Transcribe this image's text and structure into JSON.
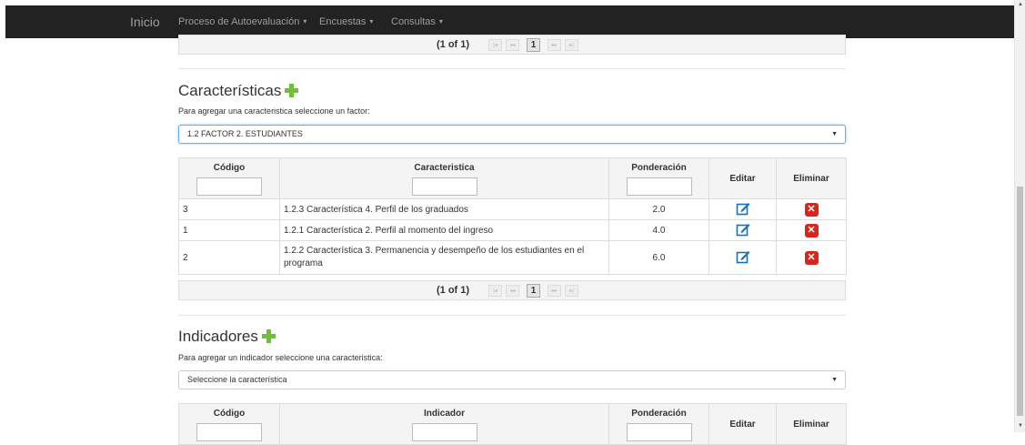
{
  "navbar": {
    "brand": "Inicio",
    "menus": [
      {
        "label": "Proceso de Autoevaluación"
      },
      {
        "label": "Encuestas"
      },
      {
        "label": "Consultas"
      }
    ]
  },
  "top_paginator": {
    "text": "(1 of 1)",
    "page": "1"
  },
  "caracteristicas": {
    "title": "Características",
    "hint": "Para agregar una caracteristica seleccione un factor:",
    "selected_factor": "1.2 FACTOR 2. ESTUDIANTES",
    "columns": [
      "Código",
      "Caracteristica",
      "Ponderación",
      "Editar",
      "Eliminar"
    ],
    "rows": [
      {
        "codigo": "3",
        "caracteristica": "1.2.3 Característica 4. Perfil de los graduados",
        "ponderacion": "2.0"
      },
      {
        "codigo": "1",
        "caracteristica": "1.2.1 Característica 2. Perfil al momento del ingreso",
        "ponderacion": "4.0"
      },
      {
        "codigo": "2",
        "caracteristica": "1.2.2 Característica 3. Permanencia y desempeño de los estudiantes en el programa",
        "ponderacion": "6.0"
      }
    ],
    "paginator": {
      "text": "(1 of 1)",
      "page": "1"
    }
  },
  "indicadores": {
    "title": "Indicadores",
    "hint": "Para agregar un indicador seleccione una caracteristica:",
    "select_placeholder": "Seleccione la característica",
    "columns": [
      "Código",
      "Indicador",
      "Ponderación",
      "Editar",
      "Eliminar"
    ]
  },
  "icons": {
    "add": "plus-icon",
    "edit": "edit-icon",
    "delete": "delete-icon"
  },
  "colors": {
    "navbar": "#222222",
    "add_icon": "#6fbf3a",
    "delete_icon": "#d9251c",
    "edit_icon": "#1a6fb5"
  }
}
